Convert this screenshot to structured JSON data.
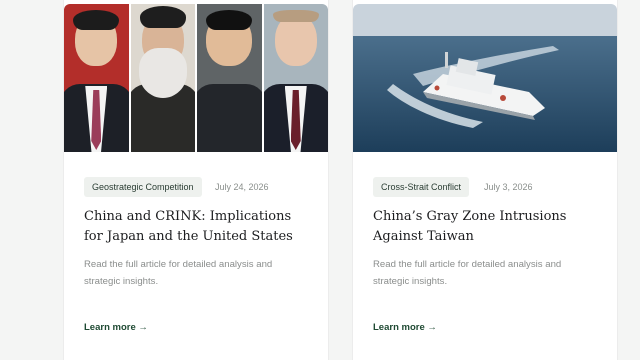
{
  "articles": [
    {
      "tag": "Geostrategic Competition",
      "date": "July 24, 2026",
      "title": "China and CRINK: Implications for Japan and the United States",
      "summary": "Read the full article for detailed analysis and strategic insights.",
      "link_label": "Learn more →",
      "image_alt": "Four leaders portrait collage"
    },
    {
      "tag": "Cross-Strait Conflict",
      "date": "July 3, 2026",
      "title": "China’s Gray Zone Intrusions Against Taiwan",
      "summary": "Read the full article for detailed analysis and strategic insights.",
      "link_label": "Learn more →",
      "image_alt": "Coast guard ship at sea"
    }
  ],
  "colors": {
    "accent": "#1f4a33",
    "tag_bg": "#eef1ee",
    "page_bg": "#f4f5f4"
  }
}
